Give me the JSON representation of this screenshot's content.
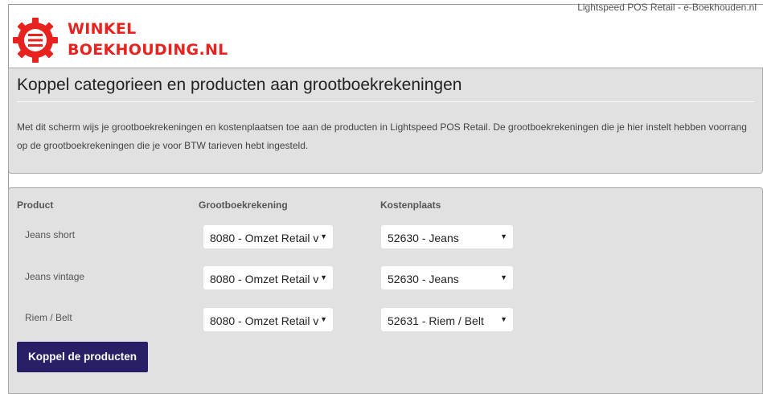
{
  "header": {
    "app_title": "Lightspeed POS Retail - e-Boekhouden.nl",
    "logo_line1": "WINKEL",
    "logo_line2": "BOEKHOUDING.NL"
  },
  "intro": {
    "title": "Koppel categorieen en producten aan grootboekrekeningen",
    "text": "Met dit scherm wijs je grootboekrekeningen en kostenplaatsen toe aan de producten in Lightspeed POS Retail. De grootboekrekeningen die je hier instelt hebben voorrang op de grootboekrekeningen die je voor BTW tarieven hebt ingesteld."
  },
  "table": {
    "columns": [
      "Product",
      "Grootboekrekening",
      "Kostenplaats"
    ],
    "rows": [
      {
        "product": "Jeans short",
        "grootboek": "8080 - Omzet Retail v",
        "kostenplaats": "52630 - Jeans"
      },
      {
        "product": "Jeans vintage",
        "grootboek": "8080 - Omzet Retail v",
        "kostenplaats": "52630 - Jeans"
      },
      {
        "product": "Riem / Belt",
        "grootboek": "8080 - Omzet Retail v",
        "kostenplaats": "52631 - Riem / Belt"
      }
    ]
  },
  "actions": {
    "submit_label": "Koppel de producten"
  },
  "icons": {
    "dropdown": "caret-down-icon",
    "logo": "gear-list-icon"
  },
  "colors": {
    "brand_red": "#e8231f",
    "button": "#282066",
    "panel": "#e1e1e1"
  }
}
